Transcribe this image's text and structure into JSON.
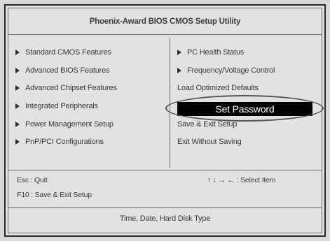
{
  "window": {
    "title": "Phoenix-Award BIOS CMOS Setup Utility"
  },
  "menu": {
    "left": [
      {
        "label": "Standard CMOS Features",
        "arrow": true
      },
      {
        "label": "Advanced BIOS Features",
        "arrow": true
      },
      {
        "label": "Advanced Chipset Features",
        "arrow": true
      },
      {
        "label": "Integrated Peripherals",
        "arrow": true
      },
      {
        "label": "Power Management Setup",
        "arrow": true
      },
      {
        "label": "PnP/PCI Configurations",
        "arrow": true
      }
    ],
    "right": [
      {
        "label": "PC Health Status",
        "arrow": true
      },
      {
        "label": "Frequency/Voltage Control",
        "arrow": true
      },
      {
        "label": "Load Optimized Defaults",
        "arrow": false
      },
      {
        "label": "Set Password",
        "arrow": false,
        "selected": true
      },
      {
        "label": "Save & Exit Setup",
        "arrow": false
      },
      {
        "label": "Exit Without Saving",
        "arrow": false
      }
    ]
  },
  "help": {
    "esc": "Esc : Quit",
    "f10": "F10 : Save & Exit Setup",
    "nav": "↑ ↓ → ← : Select Item"
  },
  "footer": {
    "description": "Time, Date, Hard Disk Type"
  },
  "colors": {
    "background": "#d9d9d9",
    "highlight_bg": "#000000",
    "highlight_fg": "#ffffff",
    "text": "#3a3a3a"
  }
}
